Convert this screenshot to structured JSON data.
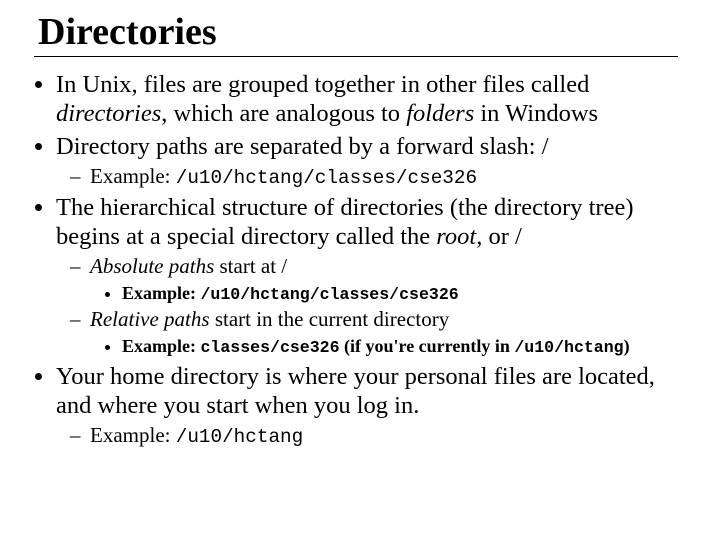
{
  "title": "Directories",
  "b1": {
    "pre": "In Unix, files are grouped together in other files called ",
    "it1": "directories",
    "mid": ", which are analogous to ",
    "it2": "folders",
    "post": " in Windows"
  },
  "b2": "Directory paths are separated by a forward slash: /",
  "b2a": {
    "label": "Example: ",
    "path": "/u10/hctang/classes/cse326"
  },
  "b3": {
    "pre": "The hierarchical structure of directories (the directory tree) begins at a special directory called the ",
    "it": "root",
    "post": ", or /"
  },
  "b3a": {
    "it": "Absolute paths",
    "rest": " start at /"
  },
  "b3a1": {
    "label": "Example: ",
    "path": "/u10/hctang/classes/cse326"
  },
  "b3b": {
    "it": "Relative paths",
    "rest": " start in the current directory"
  },
  "b3b1": {
    "label": "Example: ",
    "path": "classes/cse326",
    "tail_pre": "  (if you're currently in ",
    "tail_path": "/u10/hctang",
    "tail_post": ")"
  },
  "b4": "Your home directory is where your personal files are located, and where you start when you log in.",
  "b4a": {
    "label": "Example: ",
    "path": "/u10/hctang"
  }
}
